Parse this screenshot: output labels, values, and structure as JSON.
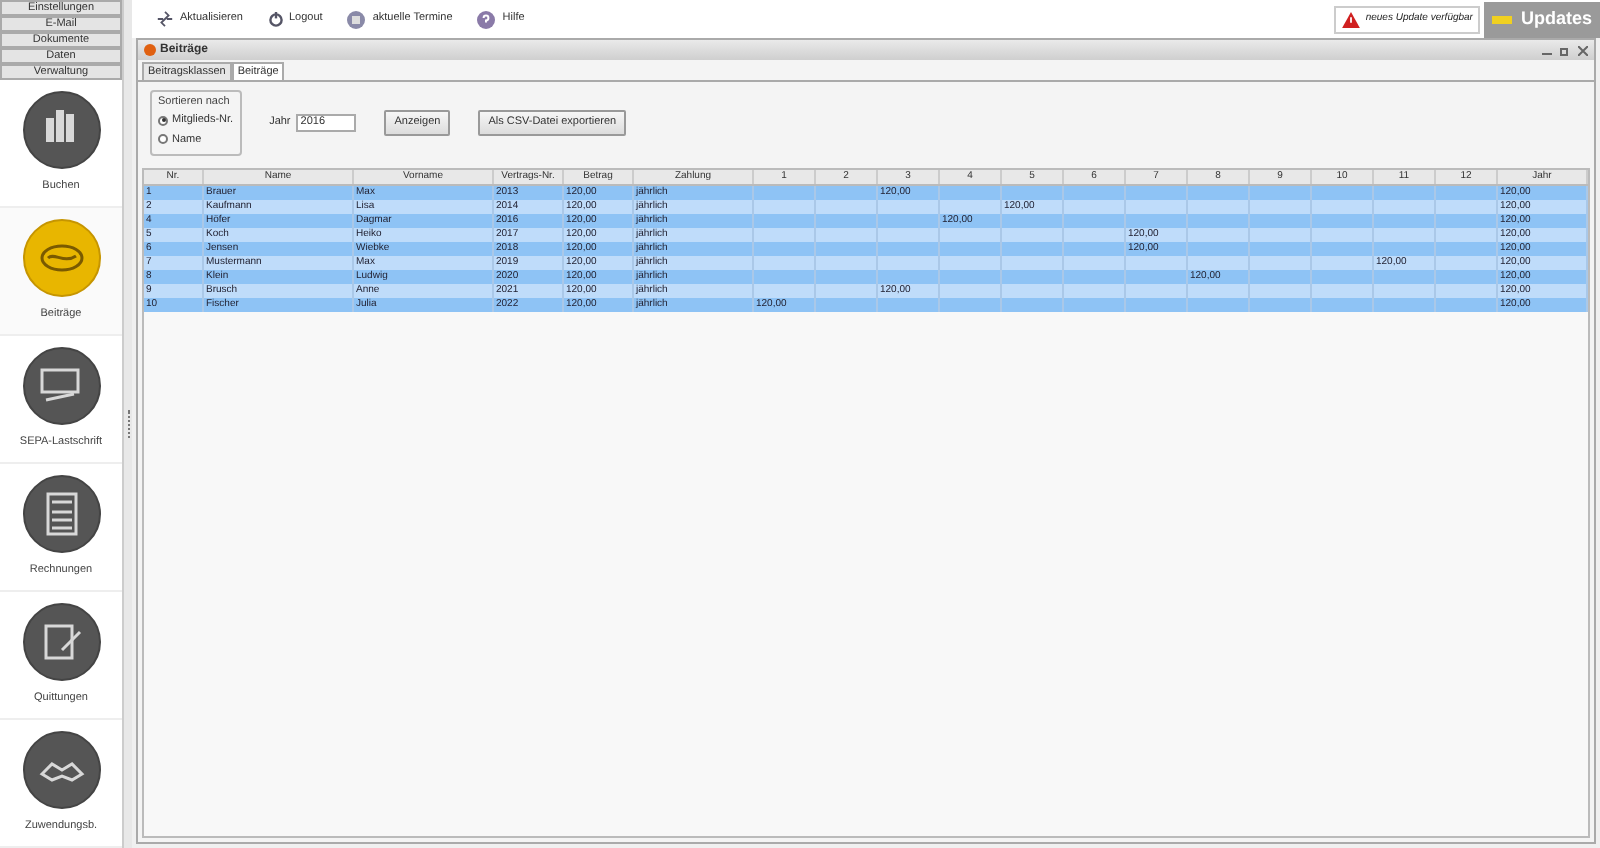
{
  "menu": [
    "Einstellungen",
    "E-Mail",
    "Dokumente",
    "Daten",
    "Verwaltung"
  ],
  "nav": [
    {
      "label": "Buchen",
      "kind": "chart",
      "selected": false
    },
    {
      "label": "Beiträge",
      "kind": "coin",
      "selected": true
    },
    {
      "label": "SEPA-Lastschrift",
      "kind": "card",
      "selected": false
    },
    {
      "label": "Rechnungen",
      "kind": "calculator",
      "selected": false
    },
    {
      "label": "Quittungen",
      "kind": "pen",
      "selected": false
    },
    {
      "label": "Zuwendungsb.",
      "kind": "handshake",
      "selected": false
    }
  ],
  "toolbar": [
    {
      "label": "Aktualisieren",
      "kind": "refresh"
    },
    {
      "label": "Logout",
      "kind": "logout"
    },
    {
      "label": "aktuelle Termine",
      "kind": "calendar"
    },
    {
      "label": "Hilfe",
      "kind": "help"
    }
  ],
  "update_notice": "neues Update verfügbar",
  "updates_button": "Updates",
  "window": {
    "title": "Beiträge"
  },
  "tabs": [
    {
      "label": "Beitragsklassen",
      "selected": false
    },
    {
      "label": "Beiträge",
      "selected": true
    }
  ],
  "sort": {
    "legend": "Sortieren nach",
    "options": [
      {
        "label": "Mitglieds-Nr.",
        "selected": true
      },
      {
        "label": "Name",
        "selected": false
      }
    ]
  },
  "year": {
    "label": "Jahr",
    "value": "2016"
  },
  "buttons": [
    "Anzeigen",
    "Als CSV-Datei exportieren"
  ],
  "table": {
    "columns": [
      "Nr.",
      "Name",
      "Vorname",
      "Vertrags-Nr.",
      "Betrag",
      "Zahlung",
      "1",
      "2",
      "3",
      "4",
      "5",
      "6",
      "7",
      "8",
      "9",
      "10",
      "11",
      "12",
      "Jahr"
    ],
    "rows": [
      {
        "cells": [
          "1",
          "Brauer",
          "Max",
          "2013",
          "120,00",
          "jährlich",
          null,
          null,
          "120,00",
          null,
          null,
          null,
          null,
          null,
          null,
          null,
          null,
          null,
          "120,00"
        ]
      },
      {
        "cells": [
          "2",
          "Kaufmann",
          "Lisa",
          "2014",
          "120,00",
          "jährlich",
          null,
          null,
          null,
          null,
          "120,00",
          null,
          null,
          null,
          null,
          null,
          null,
          null,
          "120,00"
        ]
      },
      {
        "cells": [
          "4",
          "Höfer",
          "Dagmar",
          "2016",
          "120,00",
          "jährlich",
          null,
          null,
          null,
          "120,00",
          null,
          null,
          null,
          null,
          null,
          null,
          null,
          null,
          "120,00"
        ]
      },
      {
        "cells": [
          "5",
          "Koch",
          "Heiko",
          "2017",
          "120,00",
          "jährlich",
          null,
          null,
          null,
          null,
          null,
          null,
          "120,00",
          null,
          null,
          null,
          null,
          null,
          "120,00"
        ]
      },
      {
        "cells": [
          "6",
          "Jensen",
          "Wiebke",
          "2018",
          "120,00",
          "jährlich",
          null,
          null,
          null,
          null,
          null,
          null,
          "120,00",
          null,
          null,
          null,
          null,
          null,
          "120,00"
        ]
      },
      {
        "cells": [
          "7",
          "Mustermann",
          "Max",
          "2019",
          "120,00",
          "jährlich",
          null,
          null,
          null,
          null,
          null,
          null,
          null,
          null,
          null,
          null,
          "120,00",
          null,
          "120,00"
        ]
      },
      {
        "cells": [
          "8",
          "Klein",
          "Ludwig",
          "2020",
          "120,00",
          "jährlich",
          null,
          null,
          null,
          null,
          null,
          null,
          null,
          "120,00",
          null,
          null,
          null,
          null,
          "120,00"
        ]
      },
      {
        "cells": [
          "9",
          "Brusch",
          "Anne",
          "2021",
          "120,00",
          "jährlich",
          null,
          null,
          "120,00",
          null,
          null,
          null,
          null,
          null,
          null,
          null,
          null,
          null,
          "120,00"
        ]
      },
      {
        "cells": [
          "10",
          "Fischer",
          "Julia",
          "2022",
          "120,00",
          "jährlich",
          "120,00",
          null,
          null,
          null,
          null,
          null,
          null,
          null,
          null,
          null,
          null,
          null,
          "120,00"
        ]
      }
    ]
  }
}
